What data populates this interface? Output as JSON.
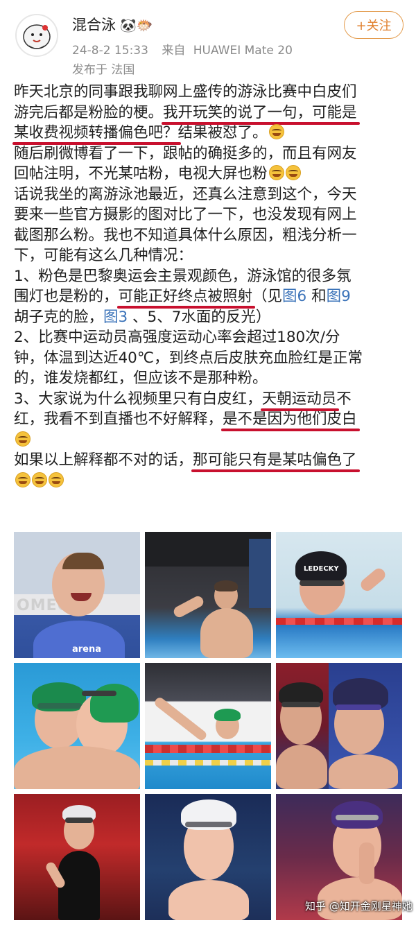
{
  "user": {
    "name": "混合泳",
    "name_emojis": "🐼🐡",
    "time": "24-8-2 15:33",
    "source_prefix": "来自",
    "device": "HUAWEI Mate 20",
    "posted_from": "发布于 法国",
    "follow_label": "+关注"
  },
  "post": {
    "l1": "昨天北京的同事跟我聊网上盛传的游泳比赛中白皮们",
    "l2a": "游完后都是粉脸的梗。",
    "l2b": "我开玩笑的说了一句，可能是",
    "l3a": "某收费视频转播偏色吧？",
    "l3b": "结果被怼了。",
    "l4": "随后刷微博看了一下，跟帖的确挺多的，而且有网友",
    "l5": "回帖注明，不光某咕粉，电视大屏也粉",
    "l6": "话说我坐的离游泳池最近，还真么注意到这个，今天",
    "l7": "要来一些官方摄影的图对比了一下，也没发现有网上",
    "l8": "截图那么粉。我也不知道具体什么原因，粗浅分析一",
    "l9": "下，可能有这么几种情况：",
    "l10": "1、粉色是巴黎奥运会主景观颜色，游泳馆的很多氛",
    "l11a": "围灯也是粉的，",
    "l11b": "可能正好终点被照射",
    "l11c": "（见",
    "l11d": "图6",
    "l11e": " 和",
    "l11f": "图9",
    "l12a": "胡子克的脸，",
    "l12b": "图3",
    "l12c": " 、5、7水面的反光）",
    "l13": "2、比赛中运动员高强度运动心率会超过180次/分",
    "l14": "钟，体温到达近40℃，到终点后皮肤充血脸红是正常",
    "l15": "的，谁发烧都红，但应该不是那种粉。",
    "l16a": "3、大家说为什么视频里只有白皮红，",
    "l16b": "天朝运动员",
    "l16c": "不",
    "l17a": "红，我看不到直播也不好解释，",
    "l17b": "是不是因为他们皮白",
    "l18a": "如果以上解释都不对的话，",
    "l18b": "那可能只有是某咕偏色了"
  },
  "photo_labels": {
    "p1": "OMEGA",
    "p1b": "arena",
    "p3": "LEDECKY"
  },
  "watermark": "知乎 @知开金刚星神她"
}
